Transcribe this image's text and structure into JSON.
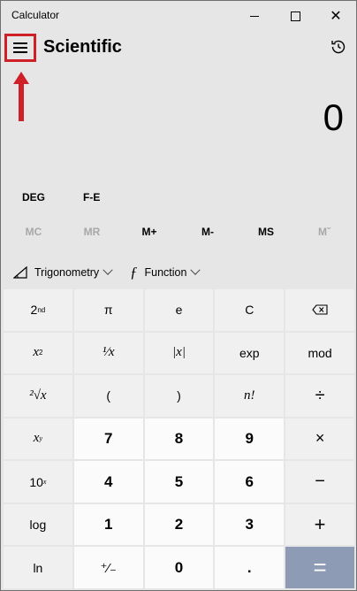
{
  "window": {
    "title": "Calculator"
  },
  "header": {
    "mode_title": "Scientific"
  },
  "display": {
    "value": "0"
  },
  "modes": {
    "angle": "DEG",
    "fe": "F-E"
  },
  "memory": [
    "MC",
    "MR",
    "M+",
    "M-",
    "MS",
    "Mˇ"
  ],
  "dropdowns": {
    "trig": "Trigonometry",
    "func": "Function"
  },
  "keys": {
    "r1": [
      "2",
      "π",
      "e",
      "C",
      "backspace-icon"
    ],
    "r2": [
      "x²",
      "¹⁄x",
      "|x|",
      "exp",
      "mod"
    ],
    "r3": [
      "²√x",
      "(",
      ")",
      "n!",
      "÷"
    ],
    "r4": [
      "xʸ",
      "7",
      "8",
      "9",
      "×"
    ],
    "r5": [
      "10ˣ",
      "4",
      "5",
      "6",
      "−"
    ],
    "r6": [
      "log",
      "1",
      "2",
      "3",
      "+"
    ],
    "r7": [
      "ln",
      "⁺⁄₋",
      "0",
      ".",
      "="
    ]
  },
  "key_extra": {
    "second_sup": "nd",
    "x_sq_sup": "2",
    "x_pow_sup": "y",
    "ten_pow_sup": "x",
    "root_index": "2"
  }
}
